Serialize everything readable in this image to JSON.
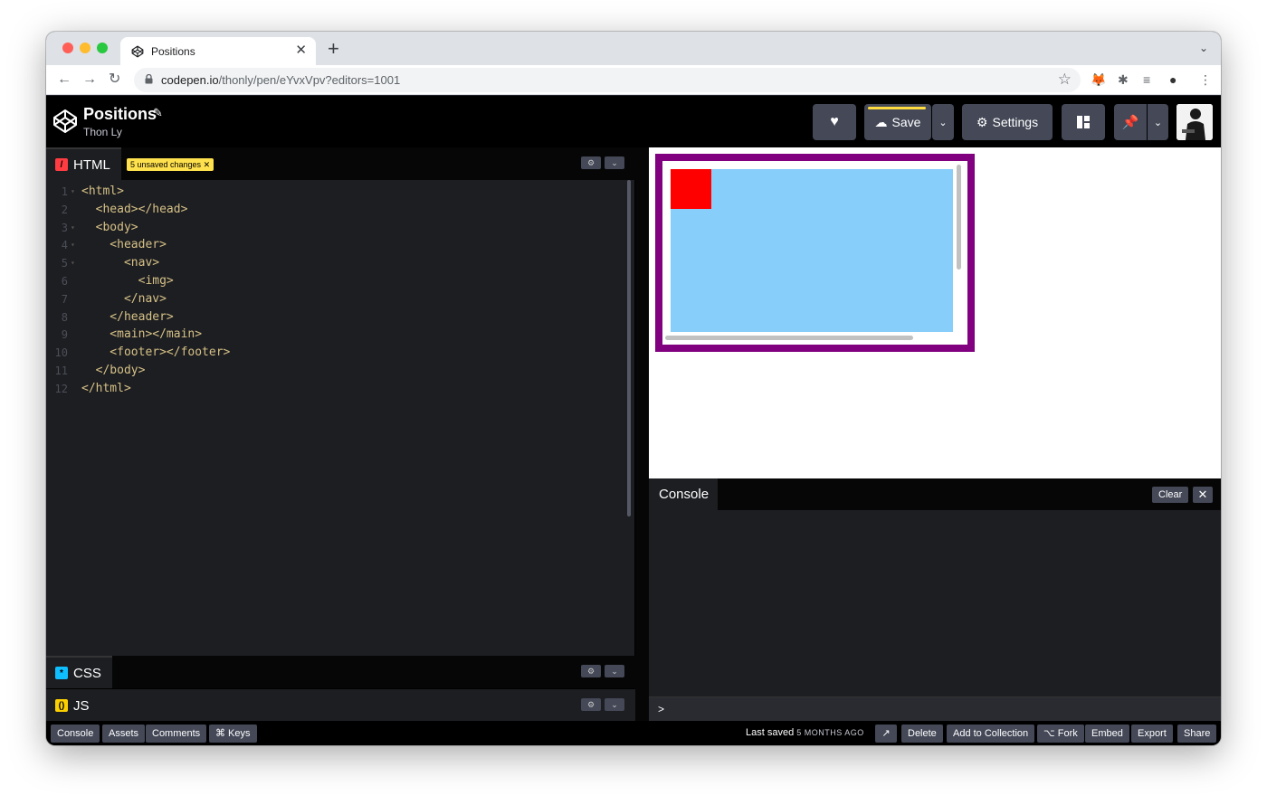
{
  "browser": {
    "tab_title": "Positions",
    "tab_close": "✕",
    "new_tab": "+",
    "url_host": "codepen.io",
    "url_path": "/thonly/pen/eYvxVpv?editors=1001"
  },
  "header": {
    "pen_title": "Positions",
    "author": "Thon Ly",
    "save_label": "Save",
    "settings_label": "Settings"
  },
  "editors": {
    "html": {
      "label": "HTML",
      "unsaved_badge": "5 unsaved changes",
      "lines": [
        {
          "n": "1",
          "code": "<html>",
          "fold": true
        },
        {
          "n": "2",
          "code": "  <head></head>",
          "fold": false
        },
        {
          "n": "3",
          "code": "  <body>",
          "fold": true
        },
        {
          "n": "4",
          "code": "    <header>",
          "fold": true
        },
        {
          "n": "5",
          "code": "      <nav>",
          "fold": true
        },
        {
          "n": "6",
          "code": "        <img>",
          "fold": false
        },
        {
          "n": "7",
          "code": "      </nav>",
          "fold": false
        },
        {
          "n": "8",
          "code": "    </header>",
          "fold": false
        },
        {
          "n": "9",
          "code": "    <main></main>",
          "fold": false
        },
        {
          "n": "10",
          "code": "    <footer></footer>",
          "fold": false
        },
        {
          "n": "11",
          "code": "  </body>",
          "fold": false
        },
        {
          "n": "12",
          "code": "</html>",
          "fold": false
        }
      ]
    },
    "css": {
      "label": "CSS"
    },
    "js": {
      "label": "JS"
    }
  },
  "console": {
    "label": "Console",
    "clear_label": "Clear",
    "close_label": "✕",
    "prompt": ">"
  },
  "footer": {
    "left_buttons": [
      "Console",
      "Assets",
      "Comments",
      "⌘ Keys"
    ],
    "last_saved_label": "Last saved",
    "last_saved_ago": "5 MONTHS AGO",
    "right_buttons": [
      "Delete",
      "Add to Collection",
      "⌥ Fork",
      "Embed",
      "Export",
      "Share"
    ]
  },
  "colors": {
    "html_badge": "#ff3c41",
    "css_badge": "#0ebeff",
    "js_badge": "#fcd000",
    "preview_outer": "#800080",
    "preview_blue": "#87cefa",
    "preview_red": "#ff0000",
    "unsaved": "#ffe14d"
  }
}
